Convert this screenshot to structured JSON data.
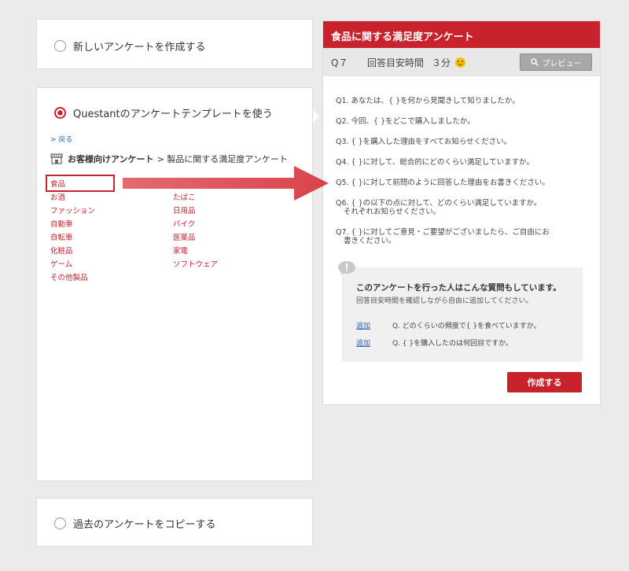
{
  "options": {
    "new_survey": "新しいアンケートを作成する",
    "use_template": "Questantのアンケートテンプレートを使う",
    "copy_past": "過去のアンケートをコピーする"
  },
  "template": {
    "back": "> 戻る",
    "breadcrumb_bold": "お客様向けアンケート",
    "breadcrumb_rest": "> 製品に関する満足度アンケート",
    "categories_left": [
      "食品",
      "お酒",
      "ファッション",
      "自動車",
      "自転車",
      "化粧品",
      "ゲーム",
      "その他製品"
    ],
    "categories_right": [
      "たばこ",
      "日用品",
      "バイク",
      "医薬品",
      "家電",
      "ソフトウェア"
    ],
    "selected_category": "食品"
  },
  "panel": {
    "title": "食品に関する満足度アンケート",
    "question_count": "Q７",
    "time_label": "回答目安時間",
    "time_value": "３分",
    "preview": "プレビュー",
    "questions": [
      "Q1. あなたは、{ }を何から見聞きして知りましたか。",
      "Q2. 今回、{ }をどこで購入しましたか。",
      "Q3. { }を購入した理由をすべてお知らせください。",
      "Q4. { }に対して、総合的にどのくらい満足していますか。",
      "Q5. { }に対して前問のように回答した理由をお書きください。",
      "Q6. { }の以下の点に対して、どのくらい満足していますか。",
      "それぞれお知らせください。",
      "Q7. { }に対してご意見・ご要望がございましたら、ご自由にお",
      "書きください。"
    ],
    "suggest_title": "このアンケートを行った人はこんな質問もしています。",
    "suggest_sub": "回答目安時間を確認しながら自由に追加してください。",
    "suggestions": [
      {
        "add": "追加",
        "text": "Q. どのくらいの頻度で{ }を食べていますか。"
      },
      {
        "add": "追加",
        "text": "Q. { }を購入したのは何回目ですか。"
      }
    ],
    "create": "作成する"
  },
  "colors": {
    "accent": "#c8232c",
    "link": "#2a62b8"
  }
}
